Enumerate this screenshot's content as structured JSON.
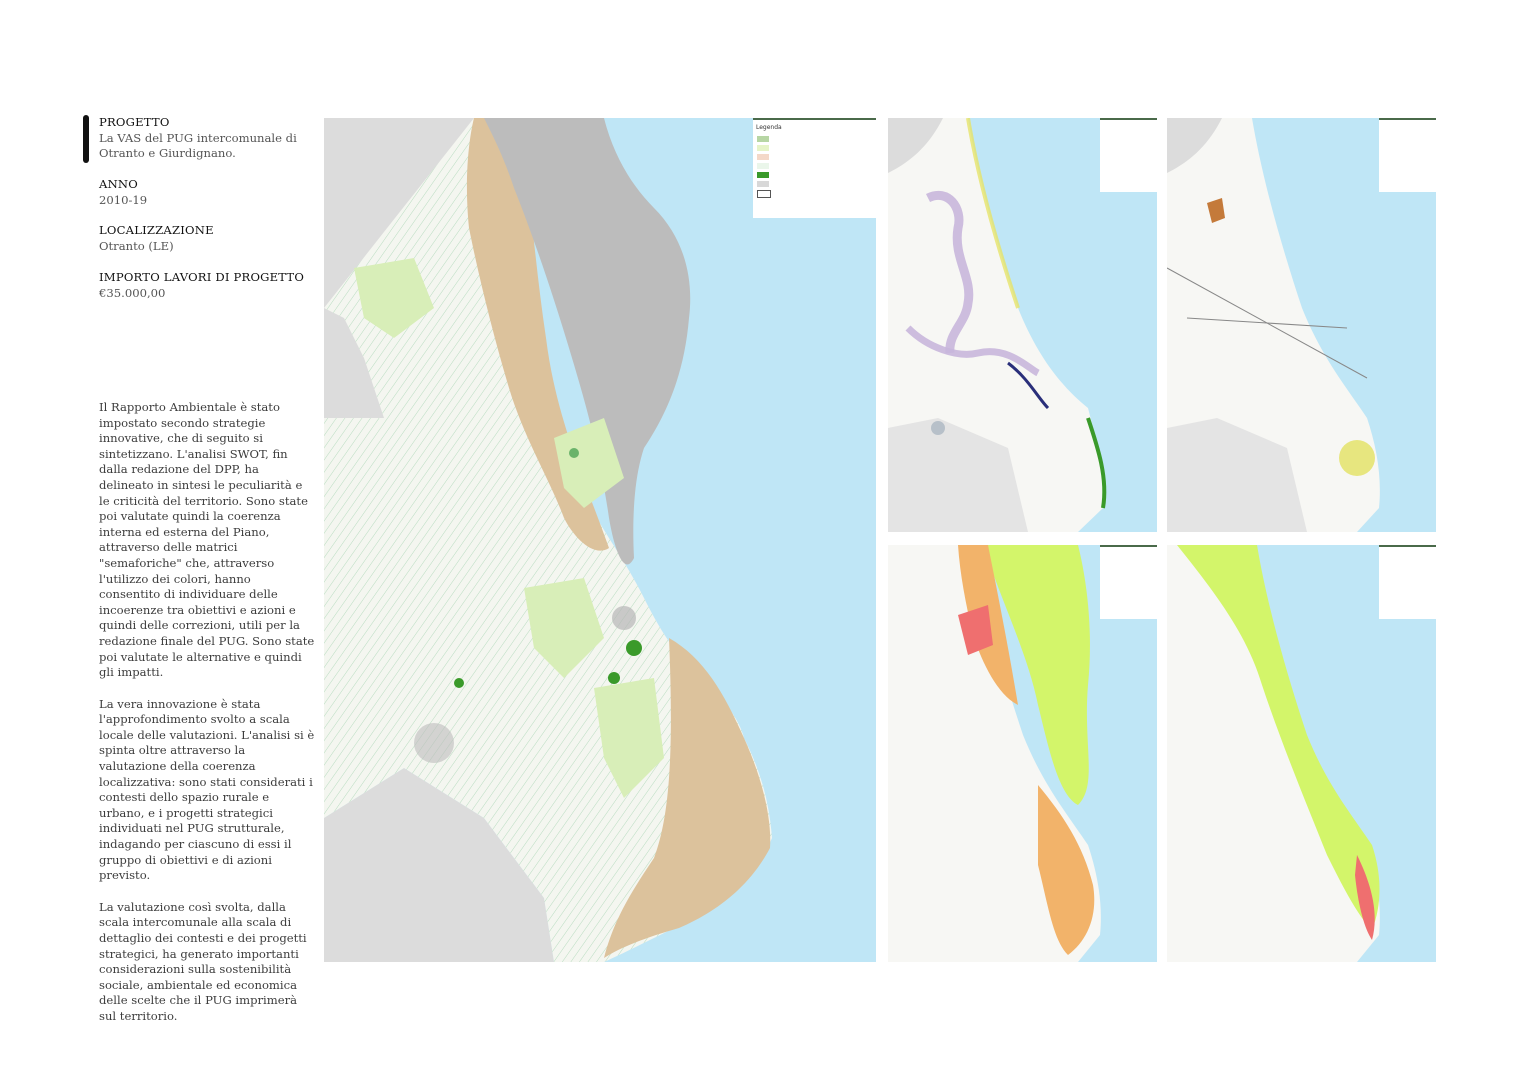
{
  "project": {
    "progetto_label": "PROGETTO",
    "progetto_value": "La VAS del PUG intercomunale di Otranto e Giurdignano.",
    "anno_label": "ANNO",
    "anno_value": "2010-19",
    "localizzazione_label": "LOCALIZZAZIONE",
    "localizzazione_value": "Otranto (LE)",
    "importo_label": "IMPORTO LAVORI DI PROGETTO",
    "importo_value": "€35.000,00"
  },
  "description": {
    "p1": "Il Rapporto Ambientale è stato impostato secondo strategie innovative, che di seguito si sintetizzano. L'analisi SWOT, fin dalla redazione del DPP, ha delineato in sintesi le peculiarità e le criticità del territorio. Sono state poi valutate quindi la coerenza interna ed esterna del Piano, attraverso delle matrici \"semaforiche\" che, attraverso l'utilizzo dei colori, hanno consentito di individuare delle incoerenze tra obiettivi e azioni e quindi delle correzioni, utili per la redazione finale del PUG. Sono state poi valutate le alternative e quindi gli impatti.",
    "p2": "La vera innovazione è stata l'approfondimento svolto a scala locale delle valutazioni. L'analisi si è spinta oltre attraverso la valutazione della coerenza localizzativa: sono stati considerati i contesti dello spazio rurale e urbano, e i progetti strategici individuati nel PUG strutturale, indagando per ciascuno di essi il gruppo di obiettivi e di azioni previsto.",
    "p3": "La valutazione così svolta, dalla scala intercomunale alla scala di dettaglio dei contesti e dei progetti strategici, ha generato importanti considerazioni sulla sostenibilità sociale, ambientale ed economica delle scelte che il PUG imprimerà sul territorio."
  },
  "colors": {
    "sea": "#bfe6f6",
    "land": "#f7f7f4",
    "outside": "#dcdcdc",
    "lagoon": "#bcbcbc",
    "tan": "#dcc29c",
    "light_green": "#d8eeb8",
    "dark_green": "#3a9a2a",
    "lime": "#d3f56a",
    "orange": "#f2b36a",
    "red": "#ef6f6f",
    "lavender": "#c8b6dc"
  },
  "maps": [
    {
      "name": "main-map",
      "legend": "Legenda"
    },
    {
      "name": "map-top-middle"
    },
    {
      "name": "map-top-right"
    },
    {
      "name": "map-bottom-middle"
    },
    {
      "name": "map-bottom-right"
    }
  ]
}
